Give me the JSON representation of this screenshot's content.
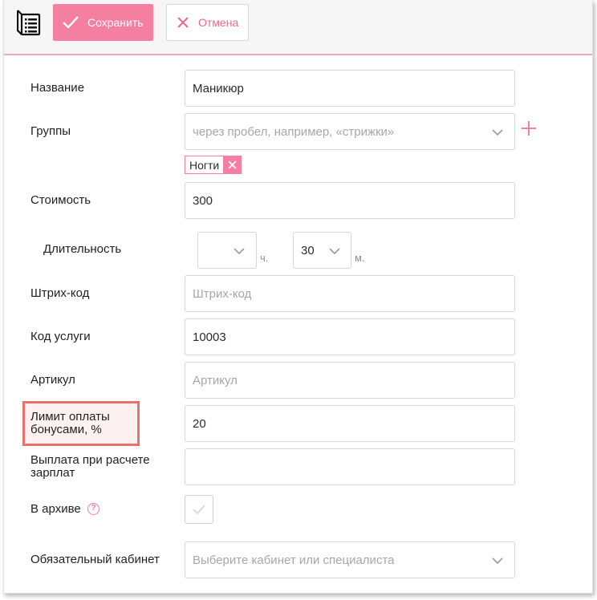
{
  "toolbar": {
    "save_label": "Сохранить",
    "cancel_label": "Отмена"
  },
  "form": {
    "name": {
      "label": "Название",
      "value": "Маникюр"
    },
    "groups": {
      "label": "Группы",
      "placeholder": "через пробел, например, «стрижки»",
      "tags": [
        "Ногти"
      ]
    },
    "price": {
      "label": "Стоимость",
      "value": "300"
    },
    "duration": {
      "label": "Длительность",
      "hours_value": "",
      "hours_unit": "ч.",
      "minutes_value": "30",
      "minutes_unit": "м."
    },
    "barcode": {
      "label": "Штрих-код",
      "placeholder": "Штрих-код"
    },
    "service_code": {
      "label": "Код услуги",
      "value": "10003"
    },
    "article": {
      "label": "Артикул",
      "placeholder": "Артикул"
    },
    "bonus_limit": {
      "label_line1": "Лимит оплаты",
      "label_line2": "бонусами, %",
      "value": "20"
    },
    "salary_payout": {
      "label_line1": "Выплата при расчете",
      "label_line2": "зарплат",
      "value": ""
    },
    "archive": {
      "label": "В архиве",
      "help_glyph": "?",
      "checked": false
    },
    "required_room": {
      "label": "Обязательный кабинет",
      "placeholder": "Выберите кабинет или специалиста"
    }
  },
  "colors": {
    "accent": "#f47fa0",
    "highlight_border": "#e8706f",
    "toolbar_bg": "#f6f6f6"
  },
  "icons": {
    "document": "document-list-icon",
    "save": "check-icon",
    "cancel": "close-icon",
    "dropdown": "chevron-down-icon",
    "add": "plus-icon",
    "help": "question-circle-icon",
    "checkbox": "checkmark-icon"
  }
}
